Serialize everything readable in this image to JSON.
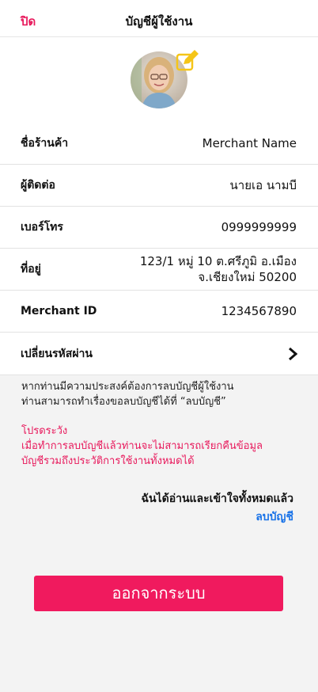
{
  "header": {
    "close_label": "ปิด",
    "title": "บัญชีผู้ใช้งาน"
  },
  "rows": [
    {
      "label": "ชื่อร้านค้า",
      "value": "Merchant Name"
    },
    {
      "label": "ผู้ติดต่อ",
      "value": "นายเอ นามบี"
    },
    {
      "label": "เบอร์โทร",
      "value": "0999999999"
    },
    {
      "label": "ที่อยู่",
      "value_line1": "123/1  หมู่ 10 ต.ศรีภูมิ อ.เมือง",
      "value_line2": "จ.เชียงใหม่ 50200"
    },
    {
      "label": "Merchant ID",
      "value": "1234567890"
    },
    {
      "label": "เปลี่ยนรหัสผ่าน"
    }
  ],
  "notice": {
    "line1": "หากท่านมีความประสงค์ต้องการลบบัญชีผู้ใช้งาน",
    "line2": "ท่านสามารถทำเรื่องขอลบบัญชีได้ที่ “ลบบัญชี”"
  },
  "warning": {
    "title": "โปรดระวัง",
    "line1": "เมื่อทำการลบบัญชีแล้วท่านจะไม่สามารถเรียกคืนข้อมูล",
    "line2": "บัญชีรวมถึงประวัติการใช้งานทั้งหมดได้"
  },
  "confirm_text": "ฉันได้อ่านและเข้าใจทั้งหมดแล้ว",
  "delete_link": "ลบบัญชี",
  "logout_label": "ออกจากระบบ",
  "colors": {
    "accent": "#e8195c",
    "link": "#1a73e8",
    "button": "#f01a5e",
    "edit_icon": "#f5c518"
  },
  "icons": {
    "edit": "edit-icon",
    "chevron": "chevron-right-icon"
  }
}
